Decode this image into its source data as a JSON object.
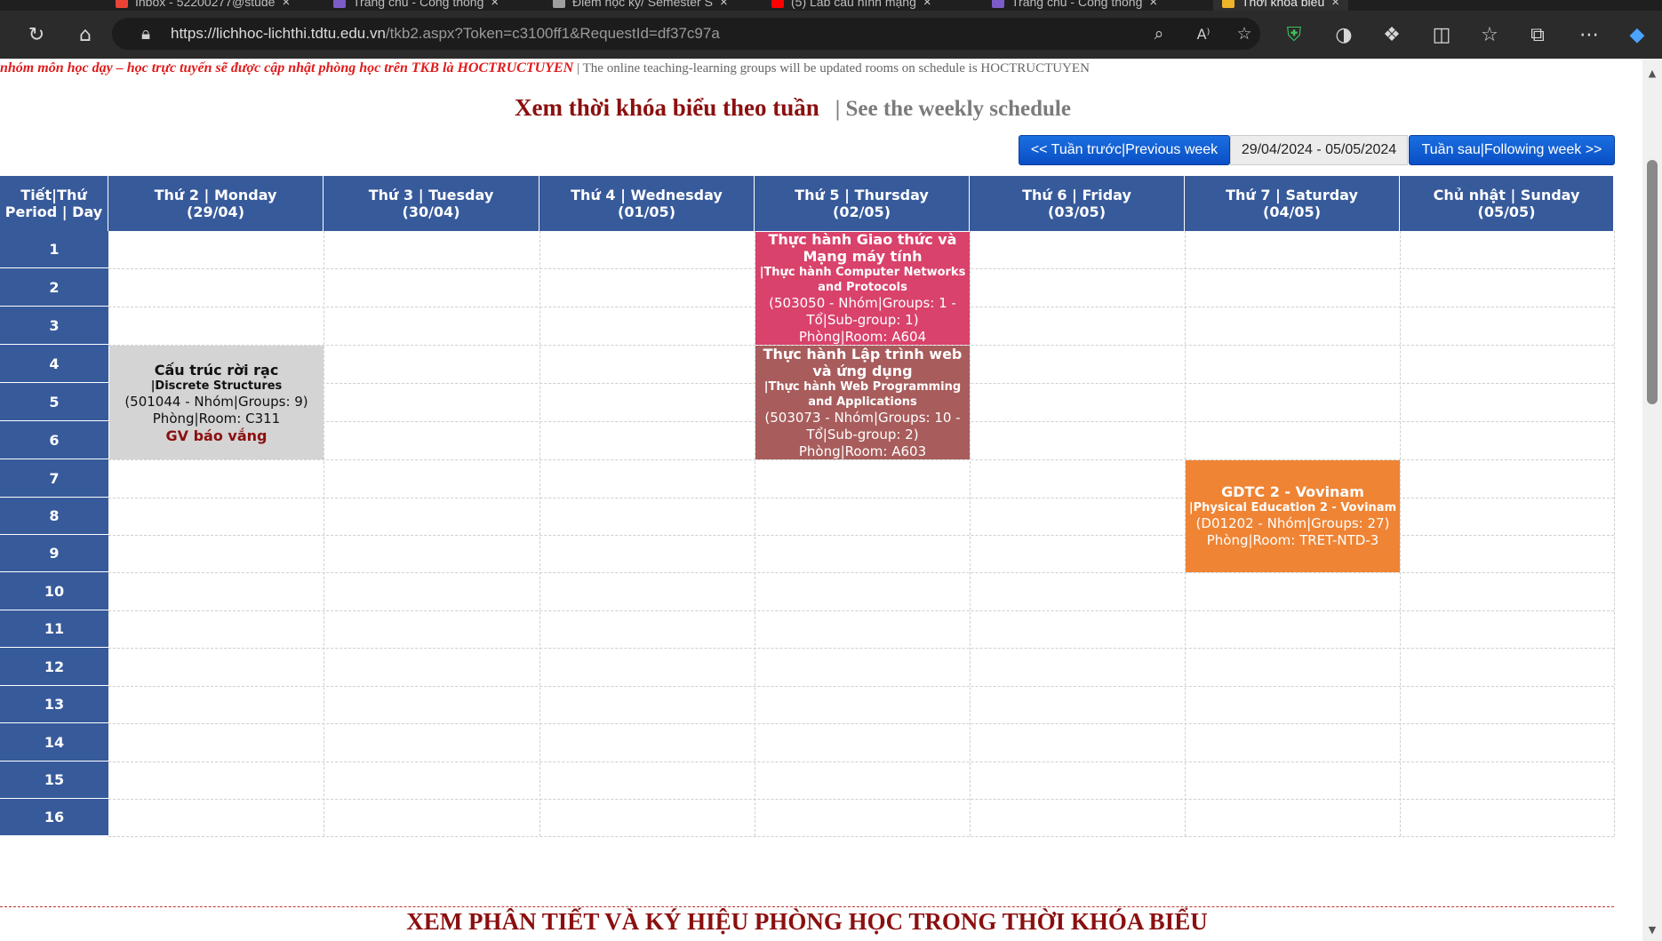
{
  "browser": {
    "tabs": [
      {
        "label": "Inbox - 52200277@stude",
        "color": "#ea4335"
      },
      {
        "label": "Trang chủ - Cổng thông",
        "color": "#7b5cc9"
      },
      {
        "label": "Điểm học kỳ/ Semester S",
        "color": "#9e9e9e"
      },
      {
        "label": "(5) Lab cấu hình mạng",
        "color": "#ff0000"
      },
      {
        "label": "Trang chủ - Cổng thông",
        "color": "#7b5cc9"
      },
      {
        "label": "Thời khóa biểu",
        "color": "#f0b429"
      }
    ],
    "url_host": "https://lichhoc-lichthi.tdtu.edu.vn",
    "url_path": "/tkb2.aspx?Token=c3100ff1&RequestId=df37c97a"
  },
  "notice": {
    "red": "nhóm môn học dạy – học trực tuyến sẽ được cập nhật phòng học trên TKB là HOCTRUCTUYEN",
    "gray": "| The online teaching-learning groups will be updated rooms on schedule is HOCTRUCTUYEN"
  },
  "heading": {
    "vi": "Xem thời khóa biểu theo tuần",
    "en": "| See the weekly schedule"
  },
  "nav": {
    "prev": "<< Tuần trước|Previous week",
    "range": "29/04/2024 - 05/05/2024",
    "next": "Tuần sau|Following week >>"
  },
  "grid": {
    "corner": [
      "Tiết|Thứ",
      "Period | Day"
    ],
    "days": [
      {
        "label": "Thứ 2 | Monday",
        "date": "(29/04)"
      },
      {
        "label": "Thứ 3 | Tuesday",
        "date": "(30/04)"
      },
      {
        "label": "Thứ 4 | Wednesday",
        "date": "(01/05)"
      },
      {
        "label": "Thứ 5 | Thursday",
        "date": "(02/05)"
      },
      {
        "label": "Thứ 6 | Friday",
        "date": "(03/05)"
      },
      {
        "label": "Thứ 7 | Saturday",
        "date": "(04/05)"
      },
      {
        "label": "Chủ nhật | Sunday",
        "date": "(05/05)"
      }
    ],
    "periods": [
      "1",
      "2",
      "3",
      "4",
      "5",
      "6",
      "7",
      "8",
      "9",
      "10",
      "11",
      "12",
      "13",
      "14",
      "15",
      "16"
    ]
  },
  "events": [
    {
      "day": 3,
      "start": 1,
      "end": 3,
      "color": "#d9426b",
      "text_color": "#ffffff",
      "lines": [
        {
          "cls": "t1",
          "text": "Thực hành Giao thức và Mạng máy tính"
        },
        {
          "cls": "t2",
          "text": "|Thực hành Computer Networks and Protocols"
        },
        {
          "cls": "",
          "text": "(503050 - Nhóm|Groups: 1 - Tổ|Sub-group: 1)"
        },
        {
          "cls": "",
          "text": "Phòng|Room: A604"
        }
      ]
    },
    {
      "day": 3,
      "start": 4,
      "end": 6,
      "color": "#a85c5c",
      "text_color": "#ffffff",
      "lines": [
        {
          "cls": "t1",
          "text": "Thực hành Lập trình web và ứng dụng"
        },
        {
          "cls": "t2",
          "text": "|Thực hành Web Programming and Applications"
        },
        {
          "cls": "",
          "text": "(503073 - Nhóm|Groups: 10 - Tổ|Sub-group: 2)"
        },
        {
          "cls": "",
          "text": "Phòng|Room: A603"
        }
      ]
    },
    {
      "day": 0,
      "start": 4,
      "end": 6,
      "color": "#d4d4d4",
      "text_color": "#111111",
      "lines": [
        {
          "cls": "t1",
          "text": "Cấu trúc rời rạc"
        },
        {
          "cls": "t2",
          "text": "|Discrete Structures"
        },
        {
          "cls": "",
          "text": "(501044 - Nhóm|Groups: 9)"
        },
        {
          "cls": "",
          "text": "Phòng|Room: C311"
        },
        {
          "cls": "absent",
          "text": "GV báo vắng"
        }
      ]
    },
    {
      "day": 5,
      "start": 7,
      "end": 9,
      "color": "#ef8434",
      "text_color": "#ffffff",
      "lines": [
        {
          "cls": "t1",
          "text": "GDTC 2 - Vovinam"
        },
        {
          "cls": "t2",
          "text": "|Physical Education 2 - Vovinam"
        },
        {
          "cls": "",
          "text": "(D01202 - Nhóm|Groups: 27)"
        },
        {
          "cls": "",
          "text": "Phòng|Room: TRET-NTD-3"
        }
      ]
    }
  ],
  "footer": {
    "title": "XEM PHÂN TIẾT VÀ KÝ HIỆU PHÒNG HỌC TRONG THỜI KHÓA BIỂU"
  },
  "icons": {
    "toolbar_left": [
      "refresh-icon",
      "home-icon"
    ],
    "address": [
      "lock-icon",
      "zoom-icon",
      "read-aloud-icon",
      "favorite-star-icon"
    ],
    "toolbar_right": [
      "shield-extension-icon",
      "extension-icon-2",
      "extensions-puzzle-icon",
      "split-screen-icon",
      "favorites-icon",
      "collections-icon",
      "more-menu-icon",
      "copilot-icon"
    ]
  }
}
